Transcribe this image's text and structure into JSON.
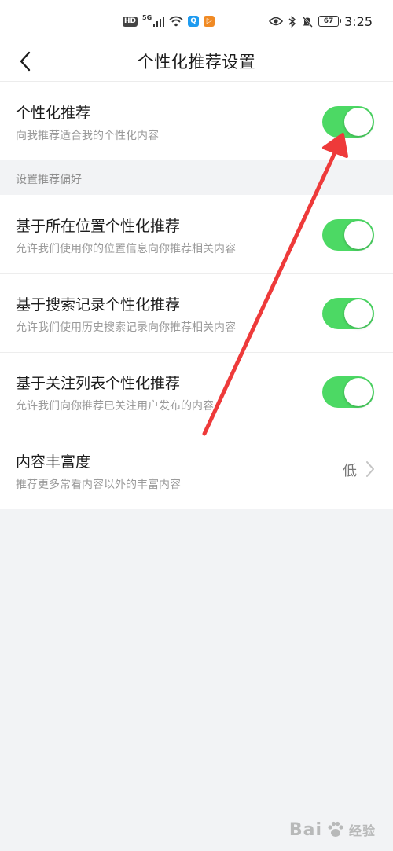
{
  "status_bar": {
    "hd": "HD",
    "net": "5G",
    "app_icon_1": "Q",
    "app_icon_2": "▷",
    "battery": "67",
    "time": "3:25",
    "icons": [
      "hd-icon",
      "signal-icon",
      "wifi-icon",
      "app-q-icon",
      "app-play-icon",
      "eye-icon",
      "bluetooth-icon",
      "mute-bell-icon",
      "battery-icon"
    ]
  },
  "header": {
    "title": "个性化推荐设置",
    "back_icon": "chevron-left-icon"
  },
  "main_toggle": {
    "title": "个性化推荐",
    "subtitle": "向我推荐适合我的个性化内容",
    "on": true
  },
  "section_header": "设置推荐偏好",
  "preferences": [
    {
      "title": "基于所在位置个性化推荐",
      "subtitle": "允许我们使用你的位置信息向你推荐相关内容",
      "on": true
    },
    {
      "title": "基于搜索记录个性化推荐",
      "subtitle": "允许我们使用历史搜索记录向你推荐相关内容",
      "on": true
    },
    {
      "title": "基于关注列表个性化推荐",
      "subtitle": "允许我们向你推荐已关注用户发布的内容",
      "on": true
    }
  ],
  "richness": {
    "title": "内容丰富度",
    "subtitle": "推荐更多常看内容以外的丰富内容",
    "value": "低"
  },
  "watermark": {
    "text": "Bai",
    "text2": "经验"
  },
  "colors": {
    "toggle_on": "#4cd964",
    "annotation_arrow": "#ee3a3a",
    "background": "#f2f3f5"
  }
}
